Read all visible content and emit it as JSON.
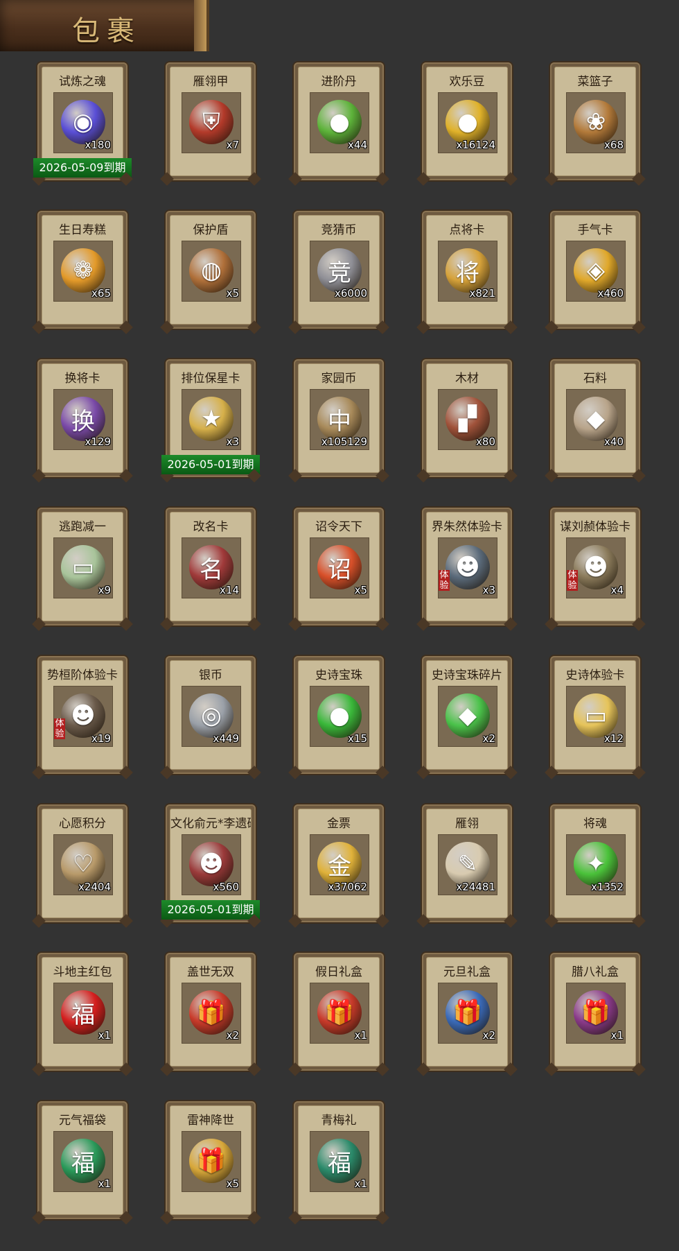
{
  "header": {
    "title": "包裹"
  },
  "items": [
    {
      "name": "试炼之魂",
      "count": "x180",
      "icon": "purple-dragon-orb-icon",
      "color": "#5a4fd6",
      "glyph": "◉",
      "expiry": "2026-05-09到期"
    },
    {
      "name": "雁翎甲",
      "count": "x7",
      "icon": "armor-icon",
      "color": "#b33a2a",
      "glyph": "⛨"
    },
    {
      "name": "进阶丹",
      "count": "x44",
      "icon": "green-pill-icon",
      "color": "#5db33a",
      "glyph": "●"
    },
    {
      "name": "欢乐豆",
      "count": "x16124",
      "icon": "gold-beans-icon",
      "color": "#e0b22a",
      "glyph": "●"
    },
    {
      "name": "菜篮子",
      "count": "x68",
      "icon": "flower-basket-icon",
      "color": "#b37a3a",
      "glyph": "❀"
    },
    {
      "name": "生日寿糕",
      "count": "x65",
      "icon": "birthday-cake-icon",
      "color": "#e39a2a",
      "glyph": "❁"
    },
    {
      "name": "保护盾",
      "count": "x5",
      "icon": "round-shield-icon",
      "color": "#b0703a",
      "glyph": "◍"
    },
    {
      "name": "竞猜币",
      "count": "x6000",
      "icon": "silver-coin-icon",
      "color": "#8f8f96",
      "glyph": "竞"
    },
    {
      "name": "点将卡",
      "count": "x821",
      "icon": "general-card-icon",
      "color": "#d6a23a",
      "glyph": "将"
    },
    {
      "name": "手气卡",
      "count": "x460",
      "icon": "luck-card-icon",
      "color": "#e0a82a",
      "glyph": "◈"
    },
    {
      "name": "换将卡",
      "count": "x129",
      "icon": "swap-general-card-icon",
      "color": "#7a4aa8",
      "glyph": "换"
    },
    {
      "name": "排位保星卡",
      "count": "x3",
      "icon": "rank-star-card-icon",
      "color": "#d6b04a",
      "glyph": "★",
      "expiry": "2026-05-01到期"
    },
    {
      "name": "家园币",
      "count": "x105129",
      "icon": "home-coin-icon",
      "color": "#a88a5a",
      "glyph": "中"
    },
    {
      "name": "木材",
      "count": "x80",
      "icon": "wood-icon",
      "color": "#a0523a",
      "glyph": "▞"
    },
    {
      "name": "石料",
      "count": "x40",
      "icon": "stone-icon",
      "color": "#b8a48a",
      "glyph": "◆"
    },
    {
      "name": "逃跑减一",
      "count": "x9",
      "icon": "escape-tag-icon",
      "color": "#a8c49a",
      "glyph": "▭"
    },
    {
      "name": "改名卡",
      "count": "x14",
      "icon": "rename-card-icon",
      "color": "#a03a3a",
      "glyph": "名"
    },
    {
      "name": "诏令天下",
      "count": "x5",
      "icon": "decree-scroll-icon",
      "color": "#d8502a",
      "glyph": "诏"
    },
    {
      "name": "界朱然体验卡",
      "count": "x3",
      "icon": "general-portrait-icon",
      "color": "#5a6a7a",
      "glyph": "☻",
      "tag": "体验"
    },
    {
      "name": "谋刘赪体验卡",
      "count": "x4",
      "icon": "general-portrait-icon",
      "color": "#8a7a5a",
      "glyph": "☻",
      "tag": "体验"
    },
    {
      "name": "势桓阶体验卡",
      "count": "x19",
      "icon": "general-portrait-icon",
      "color": "#6a5a4a",
      "glyph": "☻",
      "tag": "体验"
    },
    {
      "name": "银币",
      "count": "x449",
      "icon": "silver-coins-icon",
      "color": "#9aa0a8",
      "glyph": "◎"
    },
    {
      "name": "史诗宝珠",
      "count": "x15",
      "icon": "epic-green-orb-icon",
      "color": "#3ab83a",
      "glyph": "●"
    },
    {
      "name": "史诗宝珠碎片",
      "count": "x2",
      "icon": "green-shard-icon",
      "color": "#4ac24a",
      "glyph": "◆"
    },
    {
      "name": "史诗体验卡",
      "count": "x12",
      "icon": "gold-card-icon",
      "color": "#e6c45a",
      "glyph": "▭"
    },
    {
      "name": "心愿积分",
      "count": "x2404",
      "icon": "heart-coin-icon",
      "color": "#b89a6a",
      "glyph": "♡"
    },
    {
      "name": "文化俞元*李遗碎片",
      "count": "x560",
      "icon": "general-portrait-icon",
      "color": "#9a3a3a",
      "glyph": "☻",
      "expiry": "2026-05-01到期"
    },
    {
      "name": "金票",
      "count": "x37062",
      "icon": "gold-ticket-icon",
      "color": "#e0b23a",
      "glyph": "金"
    },
    {
      "name": "雁翎",
      "count": "x24481",
      "icon": "feather-icon",
      "color": "#d8cbb0",
      "glyph": "✎"
    },
    {
      "name": "将魂",
      "count": "x1352",
      "icon": "green-crystal-icon",
      "color": "#4ac23a",
      "glyph": "✦"
    },
    {
      "name": "斗地主红包",
      "count": "x1",
      "icon": "red-envelope-icon",
      "color": "#d41e1e",
      "glyph": "福"
    },
    {
      "name": "盖世无双",
      "count": "x2",
      "icon": "gift-box-red-icon",
      "color": "#c83a2a",
      "glyph": "🎁"
    },
    {
      "name": "假日礼盒",
      "count": "x1",
      "icon": "gift-box-red-icon",
      "color": "#c83a2a",
      "glyph": "🎁"
    },
    {
      "name": "元旦礼盒",
      "count": "x2",
      "icon": "gift-box-blue-icon",
      "color": "#3a6ab8",
      "glyph": "🎁"
    },
    {
      "name": "腊八礼盒",
      "count": "x1",
      "icon": "gift-box-purple-icon",
      "color": "#8a3a8a",
      "glyph": "🎁"
    },
    {
      "name": "元气福袋",
      "count": "x1",
      "icon": "green-lucky-bag-icon",
      "color": "#2a9a5a",
      "glyph": "福"
    },
    {
      "name": "雷神降世",
      "count": "x5",
      "icon": "gift-box-gold-icon",
      "color": "#d8a83a",
      "glyph": "🎁"
    },
    {
      "name": "青梅礼",
      "count": "x1",
      "icon": "green-lucky-bag-icon",
      "color": "#2a8a6a",
      "glyph": "福"
    }
  ]
}
